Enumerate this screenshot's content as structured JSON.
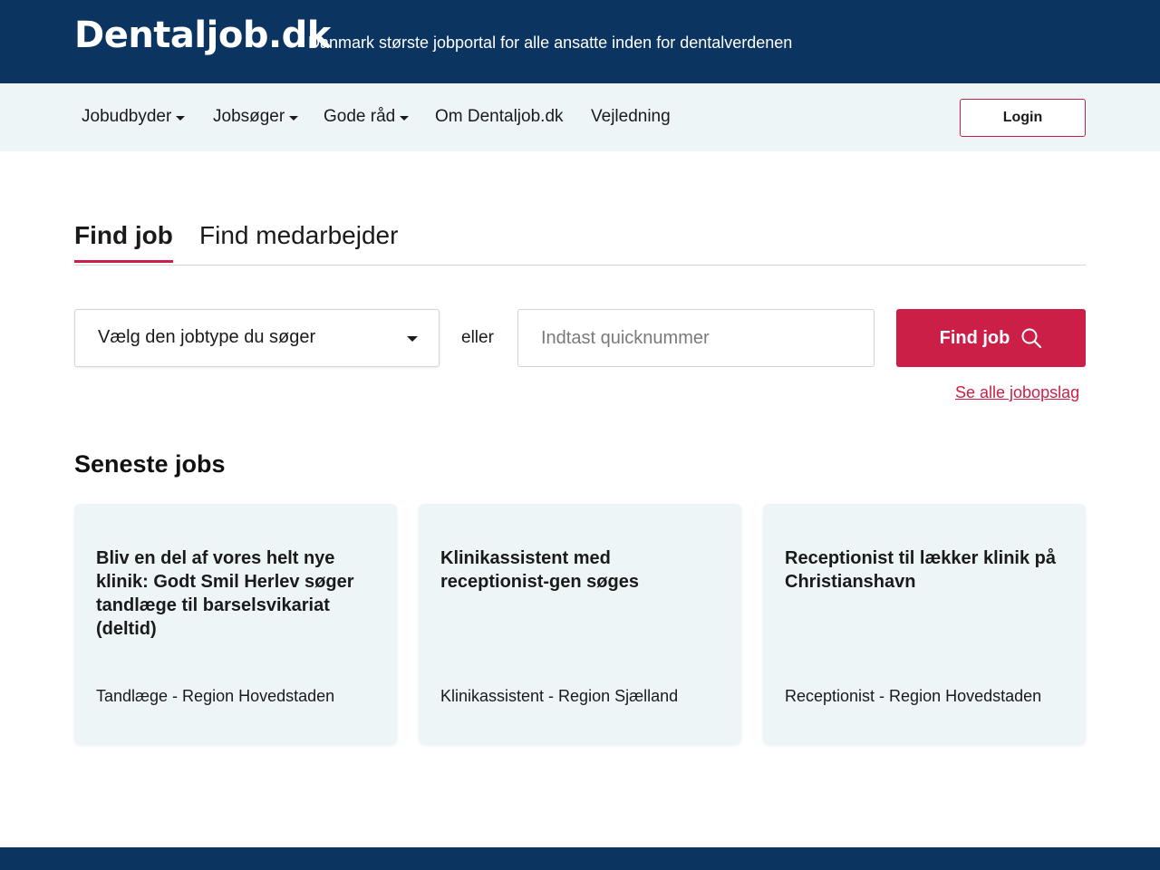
{
  "header": {
    "logo": "Dentaljob.dk",
    "tagline": "Danmark største jobportal for alle ansatte inden for dentalverdenen"
  },
  "nav": {
    "items": [
      {
        "label": "Jobudbyder",
        "dropdown": true
      },
      {
        "label": "Jobsøger",
        "dropdown": true
      },
      {
        "label": "Gode råd",
        "dropdown": true
      },
      {
        "label": "Om Dentaljob.dk",
        "dropdown": false
      },
      {
        "label": "Vejledning",
        "dropdown": false
      }
    ],
    "login_label": "Login"
  },
  "search": {
    "tabs": [
      {
        "label": "Find job",
        "active": true
      },
      {
        "label": "Find medarbejder",
        "active": false
      }
    ],
    "jobtype_select": "Vælg den jobtype du søger",
    "or_label": "eller",
    "quicknumber_placeholder": "Indtast quicknummer",
    "find_button_label": "Find job",
    "see_all_link": "Se alle jobopslag"
  },
  "latest_jobs": {
    "title": "Seneste jobs",
    "cards": [
      {
        "title": "Bliv en del af vores helt nye klinik: Godt Smil Herlev søger tandlæge til barselsvikariat (deltid)",
        "meta": "Tandlæge - Region Hovedstaden"
      },
      {
        "title": "Klinikassistent med receptionist-gen søges",
        "meta": "Klinikassistent - Region Sjælland"
      },
      {
        "title": "Receptionist til lækker klinik på Christianshavn",
        "meta": "Receptionist - Region Hovedstaden"
      }
    ]
  },
  "colors": {
    "header_bg": "#0c3461",
    "nav_bg": "#edf5f6",
    "accent": "#cc1f48",
    "card_bg": "#edf5f6"
  }
}
